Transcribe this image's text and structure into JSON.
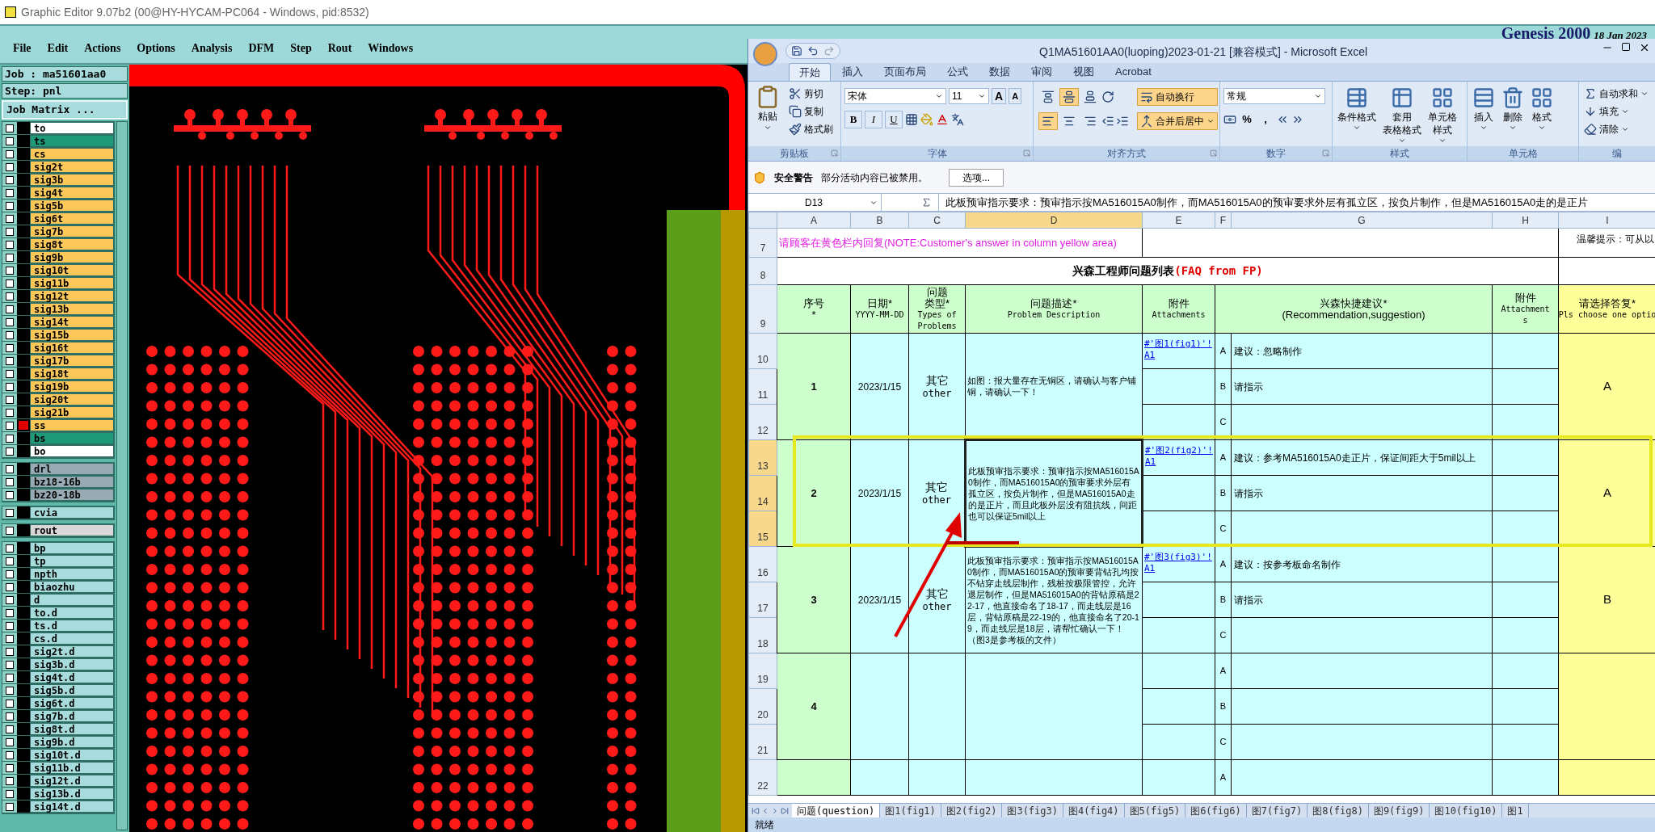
{
  "os_title": "Graphic Editor 9.07b2 (00@HY-HYCAM-PC064 - Windows, pid:8532)",
  "genesis": {
    "menu": [
      "File",
      "Edit",
      "Actions",
      "Options",
      "Analysis",
      "DFM",
      "Step",
      "Rout",
      "Windows"
    ],
    "brand": "Genesis 2000",
    "date": "18 Jan 2023",
    "job": "Job : ma51601aa0",
    "step": "Step: pnl",
    "job_matrix_button": "Job Matrix ...",
    "layer_groups": [
      {
        "layers": [
          {
            "name": "to",
            "color": "#ffffff",
            "marked": false,
            "checked": false
          },
          {
            "name": "ts",
            "color": "#1f9a78",
            "marked": false,
            "checked": false
          },
          {
            "name": "cs",
            "color": "#fcc85a",
            "marked": false,
            "checked": false
          },
          {
            "name": "sig2t",
            "color": "#fcc85a",
            "marked": false,
            "checked": false
          },
          {
            "name": "sig3b",
            "color": "#fcc85a",
            "marked": false,
            "checked": false
          },
          {
            "name": "sig4t",
            "color": "#fcc85a",
            "marked": false,
            "checked": false
          },
          {
            "name": "sig5b",
            "color": "#fcc85a",
            "marked": false,
            "checked": false
          },
          {
            "name": "sig6t",
            "color": "#fcc85a",
            "marked": false,
            "checked": false
          },
          {
            "name": "sig7b",
            "color": "#fcc85a",
            "marked": false,
            "checked": false
          },
          {
            "name": "sig8t",
            "color": "#fcc85a",
            "marked": false,
            "checked": false
          },
          {
            "name": "sig9b",
            "color": "#fcc85a",
            "marked": false,
            "checked": false
          },
          {
            "name": "sig10t",
            "color": "#fcc85a",
            "marked": false,
            "checked": false
          },
          {
            "name": "sig11b",
            "color": "#fcc85a",
            "marked": false,
            "checked": false
          },
          {
            "name": "sig12t",
            "color": "#fcc85a",
            "marked": false,
            "checked": false
          },
          {
            "name": "sig13b",
            "color": "#fcc85a",
            "marked": false,
            "checked": false
          },
          {
            "name": "sig14t",
            "color": "#fcc85a",
            "marked": false,
            "checked": false
          },
          {
            "name": "sig15b",
            "color": "#fcc85a",
            "marked": false,
            "checked": false
          },
          {
            "name": "sig16t",
            "color": "#fcc85a",
            "marked": false,
            "checked": false
          },
          {
            "name": "sig17b",
            "color": "#fcc85a",
            "marked": false,
            "checked": false
          },
          {
            "name": "sig18t",
            "color": "#fcc85a",
            "marked": false,
            "checked": false
          },
          {
            "name": "sig19b",
            "color": "#fcc85a",
            "marked": false,
            "checked": false
          },
          {
            "name": "sig20t",
            "color": "#fcc85a",
            "marked": false,
            "checked": false
          },
          {
            "name": "sig21b",
            "color": "#fcc85a",
            "marked": false,
            "checked": false
          },
          {
            "name": "ss",
            "color": "#fcc85a",
            "marked": true,
            "checked": false
          },
          {
            "name": "bs",
            "color": "#1f9a78",
            "marked": false,
            "checked": false
          },
          {
            "name": "bo",
            "color": "#ffffff",
            "marked": false,
            "checked": false
          }
        ]
      },
      {
        "layers": [
          {
            "name": "drl",
            "color": "#98aab4",
            "marked": false,
            "checked": false
          },
          {
            "name": "bz18-16b",
            "color": "#98aab4",
            "marked": false,
            "checked": false
          },
          {
            "name": "bz20-18b",
            "color": "#98aab4",
            "marked": false,
            "checked": false
          }
        ]
      },
      {
        "layers": [
          {
            "name": "cvia",
            "color": "#a8dcdc",
            "marked": false,
            "checked": false
          }
        ]
      },
      {
        "layers": [
          {
            "name": "rout",
            "color": "#d8d8d8",
            "marked": false,
            "checked": false
          }
        ]
      },
      {
        "layers": [
          {
            "name": "bp",
            "color": "#a8dcdc",
            "marked": false,
            "checked": false
          },
          {
            "name": "tp",
            "color": "#a8dcdc",
            "marked": false,
            "checked": false
          },
          {
            "name": "npth",
            "color": "#a8dcdc",
            "marked": false,
            "checked": false
          },
          {
            "name": "biaozhu",
            "color": "#a8dcdc",
            "marked": false,
            "checked": false
          },
          {
            "name": "d",
            "color": "#a8dcdc",
            "marked": false,
            "checked": false
          },
          {
            "name": "to.d",
            "color": "#a8dcdc",
            "marked": false,
            "checked": false
          },
          {
            "name": "ts.d",
            "color": "#a8dcdc",
            "marked": false,
            "checked": false
          },
          {
            "name": "cs.d",
            "color": "#a8dcdc",
            "marked": false,
            "checked": false
          },
          {
            "name": "sig2t.d",
            "color": "#a8dcdc",
            "marked": false,
            "checked": false
          },
          {
            "name": "sig3b.d",
            "color": "#a8dcdc",
            "marked": false,
            "checked": false
          },
          {
            "name": "sig4t.d",
            "color": "#a8dcdc",
            "marked": false,
            "checked": false
          },
          {
            "name": "sig5b.d",
            "color": "#a8dcdc",
            "marked": false,
            "checked": false
          },
          {
            "name": "sig6t.d",
            "color": "#a8dcdc",
            "marked": false,
            "checked": false
          },
          {
            "name": "sig7b.d",
            "color": "#a8dcdc",
            "marked": false,
            "checked": false
          },
          {
            "name": "sig8t.d",
            "color": "#a8dcdc",
            "marked": false,
            "checked": false
          },
          {
            "name": "sig9b.d",
            "color": "#a8dcdc",
            "marked": false,
            "checked": false
          },
          {
            "name": "sig10t.d",
            "color": "#a8dcdc",
            "marked": false,
            "checked": false
          },
          {
            "name": "sig11b.d",
            "color": "#a8dcdc",
            "marked": false,
            "checked": false
          },
          {
            "name": "sig12t.d",
            "color": "#a8dcdc",
            "marked": false,
            "checked": false
          },
          {
            "name": "sig13b.d",
            "color": "#a8dcdc",
            "marked": false,
            "checked": false
          },
          {
            "name": "sig14t.d",
            "color": "#a8dcdc",
            "marked": false,
            "checked": false
          }
        ]
      }
    ]
  },
  "excel": {
    "title": "Q1MA51601AA0(luoping)2023-01-21  [兼容模式] - Microsoft Excel",
    "ribbon_tabs": [
      {
        "label": "开始",
        "selected": true
      },
      {
        "label": "插入",
        "selected": false
      },
      {
        "label": "页面布局",
        "selected": false
      },
      {
        "label": "公式",
        "selected": false
      },
      {
        "label": "数据",
        "selected": false
      },
      {
        "label": "审阅",
        "selected": false
      },
      {
        "label": "视图",
        "selected": false
      },
      {
        "label": "Acrobat",
        "selected": false
      }
    ],
    "ribbon_groups": [
      {
        "kind": "clipboard",
        "label": "剪贴板",
        "big": "粘贴",
        "small": [
          "剪切",
          "复制",
          "格式刷"
        ]
      },
      {
        "kind": "font",
        "label": "字体",
        "font": "宋体",
        "size": "11",
        "grow": "A",
        "shrink": "A",
        "buttons": [
          "B",
          "I",
          "U"
        ]
      },
      {
        "kind": "alignment",
        "label": "对齐方式",
        "vertical": [
          {
            "selected": false
          },
          {
            "selected": true
          },
          {
            "selected": false
          }
        ],
        "horizontal": [
          {
            "selected": true
          },
          {
            "selected": false
          },
          {
            "selected": false
          }
        ],
        "wrap": {
          "label": "自动换行",
          "on": true
        },
        "merge": {
          "label": "合并后居中",
          "on": true
        }
      },
      {
        "kind": "number",
        "label": "数字",
        "format": "常规",
        "percent": "%",
        "comma": ","
      },
      {
        "kind": "styles",
        "label": "样式",
        "items": [
          [
            "条件格式"
          ],
          [
            "套用",
            "表格格式"
          ],
          [
            "单元格",
            "样式"
          ]
        ]
      },
      {
        "kind": "cells",
        "label": "单元格",
        "items": [
          "插入",
          "删除",
          "格式"
        ]
      },
      {
        "kind": "editing",
        "label": "编",
        "items": [
          "自动求和",
          "填充",
          "清除"
        ]
      }
    ],
    "security": {
      "title": "安全警告",
      "message": "部分活动内容已被禁用。",
      "button": "选项..."
    },
    "formula_bar": {
      "name_box": "D13",
      "formula": "此板预审指示要求：预审指示按MA516015A0制作，而MA516015A0的预审要求外层有孤立区，按负片制作，但是MA516015A0走的是正片"
    },
    "columns": [
      {
        "label": "A",
        "selected": false
      },
      {
        "label": "B",
        "selected": false
      },
      {
        "label": "C",
        "selected": false
      },
      {
        "label": "D",
        "selected": true
      },
      {
        "label": "E",
        "selected": false
      },
      {
        "label": "F",
        "selected": false
      },
      {
        "label": "G",
        "selected": false
      },
      {
        "label": "H",
        "selected": false
      },
      {
        "label": "I",
        "selected": false
      }
    ],
    "row_numbers": [
      {
        "label": "7",
        "selected": false
      },
      {
        "label": "8",
        "selected": false
      },
      {
        "label": "9",
        "selected": false
      },
      {
        "label": "10",
        "selected": false
      },
      {
        "label": "11",
        "selected": false
      },
      {
        "label": "12",
        "selected": false
      },
      {
        "label": "13",
        "selected": true
      },
      {
        "label": "14",
        "selected": true
      },
      {
        "label": "15",
        "selected": true
      },
      {
        "label": "16",
        "selected": false
      },
      {
        "label": "17",
        "selected": false
      },
      {
        "label": "18",
        "selected": false
      },
      {
        "label": "19",
        "selected": false
      },
      {
        "label": "20",
        "selected": false
      },
      {
        "label": "21",
        "selected": false
      },
      {
        "label": "22",
        "selected": false
      }
    ],
    "note": "请顾客在黄色栏内回复(NOTE:Customer's answer in column yellow area)",
    "tip": "温馨提示：可从以",
    "sheet_title": "兴森工程师问题列表",
    "sheet_title_red": "(FAQ from FP)",
    "headers": [
      [
        "序号",
        "*"
      ],
      [
        "日期*",
        "YYYY-MM-DD"
      ],
      [
        "问题",
        "类型*",
        "Types of",
        "Problems"
      ],
      [
        "问题描述*",
        "Problem Description"
      ],
      [
        "附件",
        "Attachments"
      ],
      [
        "兴森快捷建议*",
        "(Recommendation,suggestion)"
      ],
      [
        "附件",
        "Attachment",
        "s"
      ],
      [
        "请选择答复*",
        "Pls choose one optio"
      ]
    ],
    "questions": [
      {
        "no": "1",
        "date": "2023/1/15",
        "type_cn": "其它",
        "type_en": "other",
        "description": "如图：报大量存在无铜区，请确认与客户铺铜，请确认一下！",
        "link": "#'图1(fig1)'!A1",
        "active": false,
        "answer": "A",
        "options": [
          {
            "letter": "A",
            "text": "建议：忽略制作"
          },
          {
            "letter": "B",
            "text": "请指示"
          },
          {
            "letter": "C"
          }
        ]
      },
      {
        "no": "2",
        "date": "2023/1/15",
        "type_cn": "其它",
        "type_en": "other",
        "description": "此板预审指示要求：预审指示按MA516015A0制作，而MA516015A0的预审要求外层有孤立区，按负片制作，但是MA516015A0走的是正片，而且此板外层没有阻抗线，间距也可以保证5mil以上",
        "link": "#'图2(fig2)'!A1",
        "active": true,
        "answer": "A",
        "options": [
          {
            "letter": "A",
            "text": "建议：参考MA516015A0走正片，保证间距大于5mil以上"
          },
          {
            "letter": "B",
            "text": "请指示"
          },
          {
            "letter": "C"
          }
        ]
      },
      {
        "no": "3",
        "date": "2023/1/15",
        "type_cn": "其它",
        "type_en": "other",
        "description": "此板预审指示要求：预审指示按MA516015A0制作，而MA516015A0的预审要背钻孔均按不钻穿走线层制作，残桩按极限管控，允许退层制作，但是MA516015A0的背钻原稿是22-17，他直接命名了18-17，而走线层是16层，背钻原稿是22-19的，他直接命名了20-19，而走线层是18层，请帮忙确认一下！（图3是参考板的文件）",
        "link": "#'图3(fig3)'!A1",
        "active": false,
        "answer": "B",
        "options": [
          {
            "letter": "A",
            "text": "建议：按参考板命名制作"
          },
          {
            "letter": "B",
            "text": "请指示"
          },
          {
            "letter": "C"
          }
        ]
      },
      {
        "no": "4",
        "active": false,
        "options": [
          {
            "letter": "A"
          },
          {
            "letter": "B"
          },
          {
            "letter": "C"
          }
        ]
      },
      {
        "active": false,
        "options": [
          {
            "letter": "A"
          }
        ]
      }
    ],
    "sheet_tabs": [
      {
        "label": "问题(question)",
        "selected": true
      },
      {
        "label": "图1(fig1)",
        "selected": false
      },
      {
        "label": "图2(fig2)",
        "selected": false
      },
      {
        "label": "图3(fig3)",
        "selected": false
      },
      {
        "label": "图4(fig4)",
        "selected": false
      },
      {
        "label": "图5(fig5)",
        "selected": false
      },
      {
        "label": "图6(fig6)",
        "selected": false
      },
      {
        "label": "图7(fig7)",
        "selected": false
      },
      {
        "label": "图8(fig8)",
        "selected": false
      },
      {
        "label": "图9(fig9)",
        "selected": false
      },
      {
        "label": "图10(fig10)",
        "selected": false
      },
      {
        "label": "图1",
        "selected": false
      }
    ],
    "status": "就绪"
  }
}
